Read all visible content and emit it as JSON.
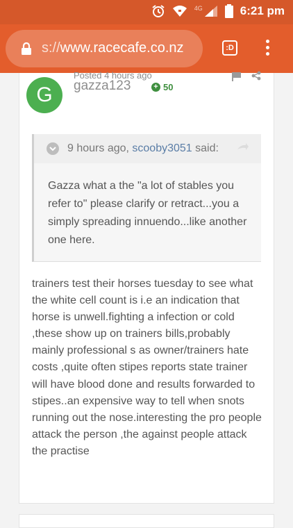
{
  "status_bar": {
    "time": "6:21 pm",
    "network": "4G",
    "icons": [
      "alarm-icon",
      "wifi-icon",
      "signal-icon",
      "battery-icon"
    ]
  },
  "browser": {
    "url_scheme": "s://",
    "url_host": "www.racecafe.co.nz",
    "tab_count": ":D",
    "menu_icon": "more-vert-icon",
    "toolbar_color": "#e35d2c"
  },
  "post": {
    "avatar_letter": "G",
    "avatar_color": "#4caf50",
    "posted": "Posted 4 hours ago",
    "username": "gazza123",
    "reputation": "50",
    "quote": {
      "time": "9 hours ago,",
      "author": "scooby3051",
      "said": "said:",
      "body": "Gazza what a the \"a lot of stables you refer to\" please clarify or retract...you a simply spreading innuendo...like another one here."
    },
    "body": "trainers test their horses tuesday to see what the white cell count is i.e an indication that horse is unwell.fighting a infection or cold ,these show up on trainers bills,probably mainly professional s as owner/trainers hate costs ,quite often stipes reports state trainer will have blood done and results forwarded to stipes..an expensive way to tell when snots running out the nose.interesting the pro people attack the person ,the against people attack the practise"
  }
}
